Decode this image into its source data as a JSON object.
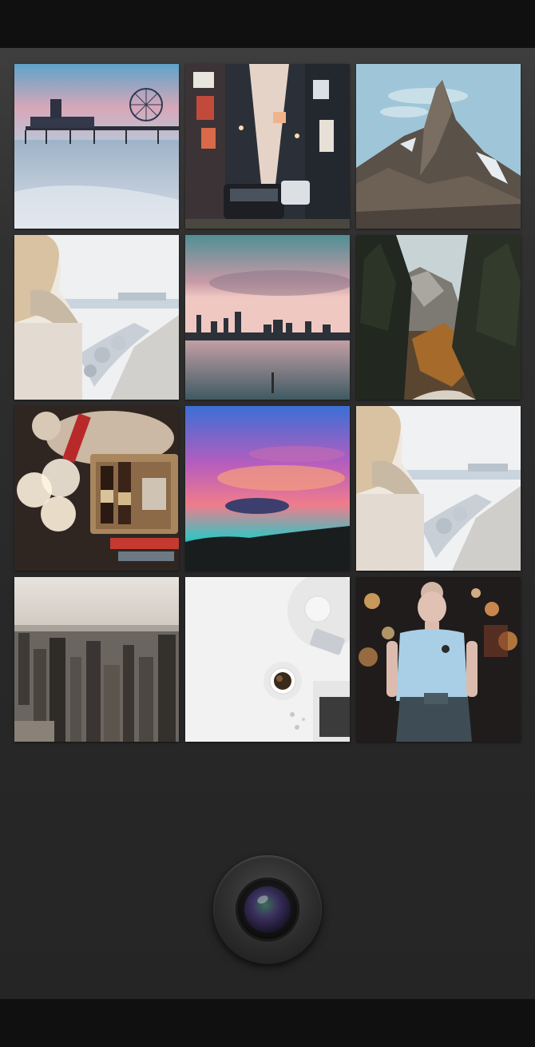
{
  "screen": {
    "title": "",
    "background": "#2b2b2b"
  },
  "gallery": {
    "photos": [
      {
        "subject": "pier-ferris-wheel-sunset"
      },
      {
        "subject": "night-city-street-signs"
      },
      {
        "subject": "rocky-mountain-peak"
      },
      {
        "subject": "woman-winter-shoreline"
      },
      {
        "subject": "city-skyline-waterfront-dusk"
      },
      {
        "subject": "pine-forest-mountain-path"
      },
      {
        "subject": "holiday-gift-basket-bottles"
      },
      {
        "subject": "colorful-sunset-clouds"
      },
      {
        "subject": "woman-winter-shoreline"
      },
      {
        "subject": "city-skyline-aerial"
      },
      {
        "subject": "coffee-cup-flatlay"
      },
      {
        "subject": "woman-night-street-lights"
      }
    ]
  },
  "camera": {
    "icon": "camera-lens-icon"
  }
}
